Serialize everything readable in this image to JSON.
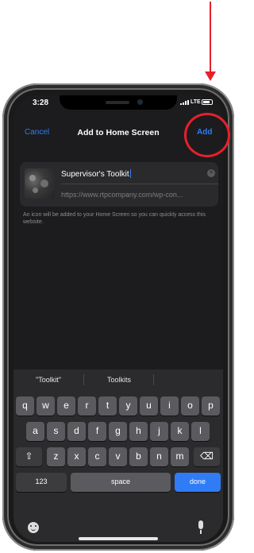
{
  "status_bar": {
    "time": "3:28",
    "network": "LTE"
  },
  "nav": {
    "cancel_label": "Cancel",
    "title": "Add to Home Screen",
    "add_label": "Add"
  },
  "bookmark": {
    "name": "Supervisor's Toolkit",
    "url": "https://www.rtpcompany.com/wp-con...",
    "info": "An icon will be added to your Home Screen so you can quickly access this website."
  },
  "keyboard": {
    "suggestions": [
      "\"Toolkit\"",
      "Toolkits"
    ],
    "row1": [
      "q",
      "w",
      "e",
      "r",
      "t",
      "y",
      "u",
      "i",
      "o",
      "p"
    ],
    "row2": [
      "a",
      "s",
      "d",
      "f",
      "g",
      "h",
      "j",
      "k",
      "l"
    ],
    "row3": [
      "z",
      "x",
      "c",
      "v",
      "b",
      "n",
      "m"
    ],
    "numbers_label": "123",
    "space_label": "space",
    "done_label": "done"
  },
  "colors": {
    "accent": "#2f7cf6",
    "annotation": "#e8202a"
  }
}
